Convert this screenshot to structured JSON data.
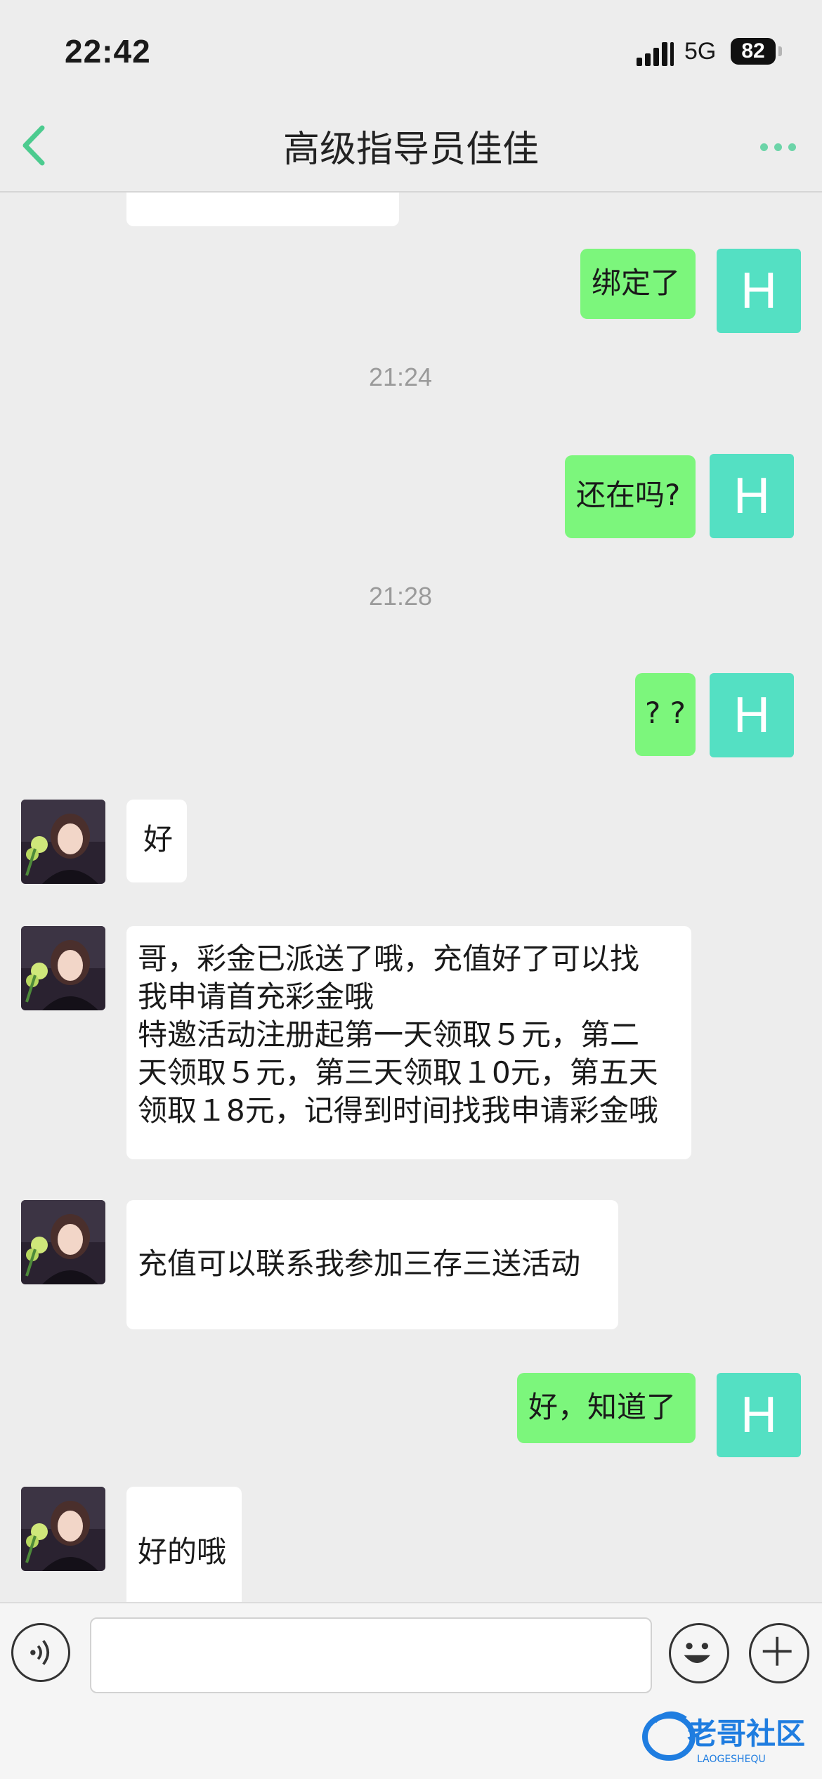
{
  "status_bar": {
    "time": "22:42",
    "network": "5G",
    "battery": "82"
  },
  "nav": {
    "title": "高级指导员佳佳"
  },
  "messages": {
    "m1_text": "绑定了",
    "avatar_letter": "H",
    "time1": "21:24",
    "m2_text": "还在吗?",
    "time2": "21:28",
    "m3_text": "? ?",
    "m4_text": "好",
    "m5_line1": "哥，彩金已派送了哦，充值好了可以找",
    "m5_line2": "我申请首充彩金哦",
    "m5_line3": "特邀活动注册起第一天领取５元，第二",
    "m5_line4": "天领取５元，第三天领取１0元，第五天",
    "m5_line5": "领取１8元，记得到时间找我申请彩金哦",
    "m6_text": "充值可以联系我参加三存三送活动",
    "m7_text": "好，知道了",
    "m8_text": "好的哦"
  },
  "input": {
    "placeholder": ""
  },
  "watermark": {
    "title": "老哥社区",
    "subtitle": "LAOGESHEQU"
  },
  "colors": {
    "background": "#ededed",
    "outgoing_bubble": "#7cf67c",
    "incoming_bubble": "#ffffff",
    "avatar_h": "#54e0c3",
    "accent": "#4ccb8f"
  },
  "icons": {
    "back": "chevron-left-icon",
    "more": "more-dots-icon",
    "voice": "voice-icon",
    "emoji": "emoji-icon",
    "plus": "plus-icon"
  }
}
